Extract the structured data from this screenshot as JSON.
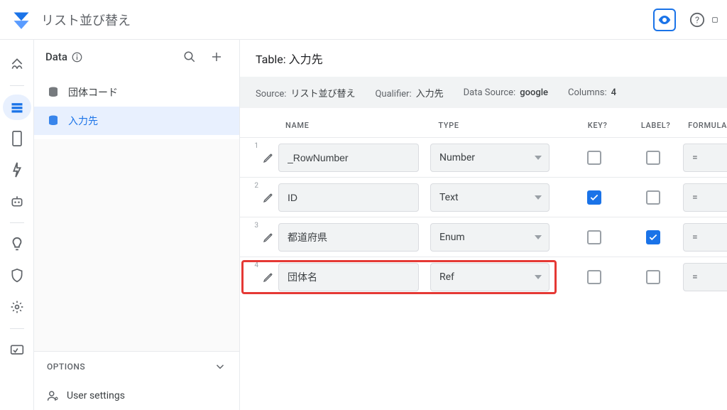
{
  "header": {
    "title": "リスト並び替え"
  },
  "sidepanel": {
    "title": "Data",
    "tables": [
      {
        "label": "団体コード",
        "selected": false
      },
      {
        "label": "入力先",
        "selected": true
      }
    ],
    "options_label": "OPTIONS",
    "user_settings_label": "User settings"
  },
  "content": {
    "title_prefix": "Table:",
    "title_value": "入力先",
    "meta": {
      "source_label": "Source:",
      "source_value": "リスト並び替え",
      "qualifier_label": "Qualifier:",
      "qualifier_value": "入力先",
      "datasource_label": "Data Source:",
      "datasource_value": "google",
      "columns_label": "Columns:",
      "columns_value": "4"
    },
    "col_headers": {
      "name": "NAME",
      "type": "TYPE",
      "key": "KEY?",
      "label": "LABEL?",
      "formula": "FORMULA"
    },
    "rows": [
      {
        "idx": "1",
        "name": "_RowNumber",
        "type": "Number",
        "key": false,
        "label": false,
        "formula": "=",
        "highlight": false
      },
      {
        "idx": "2",
        "name": "ID",
        "type": "Text",
        "key": true,
        "label": false,
        "formula": "=",
        "highlight": false
      },
      {
        "idx": "3",
        "name": "都道府県",
        "type": "Enum",
        "key": false,
        "label": true,
        "formula": "=",
        "highlight": false
      },
      {
        "idx": "4",
        "name": "団体名",
        "type": "Ref",
        "key": false,
        "label": false,
        "formula": "=",
        "highlight": true
      }
    ]
  }
}
